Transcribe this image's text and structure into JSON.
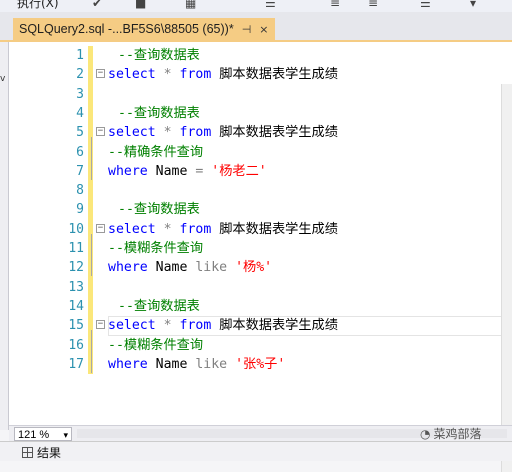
{
  "toolbar": {
    "execute_label": "执行(X)"
  },
  "tab": {
    "title": "SQLQuery2.sql -...BF5S6\\88505 (65))*",
    "pin_glyph": "⊣",
    "close_glyph": "×"
  },
  "left_panel": {
    "label": "v"
  },
  "editor": {
    "lines": [
      {
        "num": "1",
        "segments": [
          {
            "cls": "cm",
            "text": "--查询数据表"
          }
        ],
        "indent": true
      },
      {
        "num": "2",
        "segments": [
          {
            "cls": "kw",
            "text": "select"
          },
          {
            "cls": "",
            "text": " "
          },
          {
            "cls": "op",
            "text": "*"
          },
          {
            "cls": "",
            "text": " "
          },
          {
            "cls": "kw",
            "text": "from"
          },
          {
            "cls": "",
            "text": " 脚本数据表学生成绩"
          }
        ],
        "fold": true
      },
      {
        "num": "3",
        "segments": []
      },
      {
        "num": "4",
        "segments": [
          {
            "cls": "cm",
            "text": "--查询数据表"
          }
        ],
        "indent": true
      },
      {
        "num": "5",
        "segments": [
          {
            "cls": "kw",
            "text": "select"
          },
          {
            "cls": "",
            "text": " "
          },
          {
            "cls": "op",
            "text": "*"
          },
          {
            "cls": "",
            "text": " "
          },
          {
            "cls": "kw",
            "text": "from"
          },
          {
            "cls": "",
            "text": " 脚本数据表学生成绩"
          }
        ],
        "fold": true
      },
      {
        "num": "6",
        "segments": [
          {
            "cls": "cm",
            "text": "--精确条件查询"
          }
        ]
      },
      {
        "num": "7",
        "segments": [
          {
            "cls": "kw",
            "text": "where"
          },
          {
            "cls": "",
            "text": " Name "
          },
          {
            "cls": "op",
            "text": "="
          },
          {
            "cls": "",
            "text": " "
          },
          {
            "cls": "str",
            "text": "'杨老二'"
          }
        ]
      },
      {
        "num": "8",
        "segments": []
      },
      {
        "num": "9",
        "segments": [
          {
            "cls": "cm",
            "text": "--查询数据表"
          }
        ],
        "indent": true
      },
      {
        "num": "10",
        "segments": [
          {
            "cls": "kw",
            "text": "select"
          },
          {
            "cls": "",
            "text": " "
          },
          {
            "cls": "op",
            "text": "*"
          },
          {
            "cls": "",
            "text": " "
          },
          {
            "cls": "kw",
            "text": "from"
          },
          {
            "cls": "",
            "text": " 脚本数据表学生成绩"
          }
        ],
        "fold": true
      },
      {
        "num": "11",
        "segments": [
          {
            "cls": "cm",
            "text": "--模糊条件查询"
          }
        ]
      },
      {
        "num": "12",
        "segments": [
          {
            "cls": "kw",
            "text": "where"
          },
          {
            "cls": "",
            "text": " Name "
          },
          {
            "cls": "op",
            "text": "like"
          },
          {
            "cls": "",
            "text": " "
          },
          {
            "cls": "str",
            "text": "'杨%'"
          }
        ]
      },
      {
        "num": "13",
        "segments": []
      },
      {
        "num": "14",
        "segments": [
          {
            "cls": "cm",
            "text": "--查询数据表"
          }
        ],
        "indent": true
      },
      {
        "num": "15",
        "segments": [
          {
            "cls": "kw",
            "text": "select"
          },
          {
            "cls": "",
            "text": " "
          },
          {
            "cls": "op",
            "text": "*"
          },
          {
            "cls": "",
            "text": " "
          },
          {
            "cls": "kw",
            "text": "from"
          },
          {
            "cls": "",
            "text": " 脚本数据表学生成绩"
          }
        ],
        "fold": true,
        "current": true
      },
      {
        "num": "16",
        "segments": [
          {
            "cls": "cm",
            "text": "--模糊条件查询"
          }
        ]
      },
      {
        "num": "17",
        "segments": [
          {
            "cls": "kw",
            "text": "where"
          },
          {
            "cls": "",
            "text": " Name "
          },
          {
            "cls": "op",
            "text": "like"
          },
          {
            "cls": "",
            "text": " "
          },
          {
            "cls": "str",
            "text": "'张%子'"
          }
        ]
      }
    ]
  },
  "status": {
    "zoom": "121 %",
    "dropdown_glyph": "▾"
  },
  "bottom": {
    "results_label": "结果"
  },
  "watermark": {
    "text": "菜鸡部落"
  },
  "colors": {
    "tab_active": "#f5cc84",
    "keyword": "#0000ff",
    "comment": "#008000",
    "string": "#ff0000",
    "line_number": "#2b91af"
  }
}
